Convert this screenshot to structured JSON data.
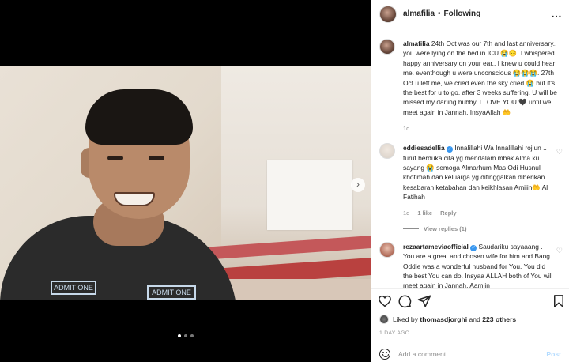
{
  "post": {
    "username": "almafilia",
    "separator": "•",
    "follow_status": "Following",
    "more_icon": "…",
    "image_dots": 3,
    "active_dot": 0,
    "shirt_text_1": "ADMIT ONE",
    "shirt_text_2": "ADMIT ONE"
  },
  "comments": [
    {
      "username": "almafilia",
      "verified": false,
      "text": "24th Oct was our 7th and last anniversary.. you were lying on the bed in ICU 😭😔. I whispered happy anniversary on your ear.. I knew u could hear me. eventhough u were unconscious 😭😭😭. 27th Oct u left me, we cried even the sky cried 😭 but it's the best for u to go. after 3 weeks suffering. U will be missed my darling hubby. I LOVE YOU 🖤 until we meet again in Jannah. InsyaAllah 🤲",
      "time": "1d",
      "likes": "",
      "reply": ""
    },
    {
      "username": "eddiesadellia",
      "verified": true,
      "text": "Innalillahi Wa Innalillahi rojiun .. turut berduka cita yg mendalam mbak Alma ku sayang 😭 semoga Almarhum Mas Odi Husnul khotimah dan keluarga yg ditinggalkan diberikan kesabaran ketabahan dan keikhlasan Amiiin🤲 Al Fatihah",
      "time": "1d",
      "likes": "1 like",
      "reply": "Reply",
      "view_replies": "View replies (1)"
    },
    {
      "username": "rezaartameviaofficial",
      "verified": true,
      "text": "Saudariku sayaaang . You are a great and chosen wife for him and Bang Oddie was a wonderful husband for You. You did the best You can do. Insyaa ALLAH both of You will meet again in Jannah. Aamiin",
      "time": "",
      "likes": "",
      "reply": ""
    }
  ],
  "actions": {
    "like_icon": "heart-icon",
    "comment_icon": "comment-icon",
    "share_icon": "share-icon",
    "save_icon": "bookmark-icon"
  },
  "likes": {
    "prefix": "Liked by",
    "user": "thomasdjorghi",
    "conj": "and",
    "others": "223 others"
  },
  "date": "1 DAY AGO",
  "add_comment": {
    "placeholder": "Add a comment…",
    "post_label": "Post"
  }
}
